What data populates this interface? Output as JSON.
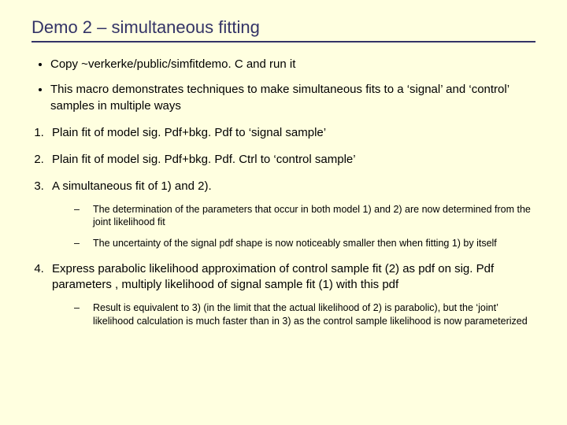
{
  "title": "Demo 2 – simultaneous fitting",
  "bullets": [
    "Copy ~verkerke/public/simfitdemo. C and run it",
    "This macro demonstrates techniques to make simultaneous fits to a ‘signal’ and ‘control’ samples in multiple ways"
  ],
  "steps": [
    {
      "text": "Plain fit of model sig. Pdf+bkg. Pdf  to ‘signal sample’",
      "subs": []
    },
    {
      "text": "Plain fit of model sig. Pdf+bkg. Pdf. Ctrl  to ‘control sample’",
      "subs": []
    },
    {
      "text": "A simultaneous fit of 1) and 2).",
      "subs": [
        "The determination of the parameters that occur in both model 1) and 2) are now determined from the joint likelihood fit",
        "The uncertainty of the signal pdf shape is now noticeably smaller then when fitting 1) by itself"
      ]
    },
    {
      "text": "Express parabolic likelihood approximation of control sample fit (2) as pdf on sig. Pdf parameters , multiply likelihood of signal sample fit (1) with this pdf",
      "subs": [
        "Result is equivalent to 3) (in the limit that the actual likelihood of 2) is parabolic), but the ‘joint’ likelihood calculation is much faster than in 3) as the control sample likelihood is now parameterized"
      ]
    }
  ]
}
